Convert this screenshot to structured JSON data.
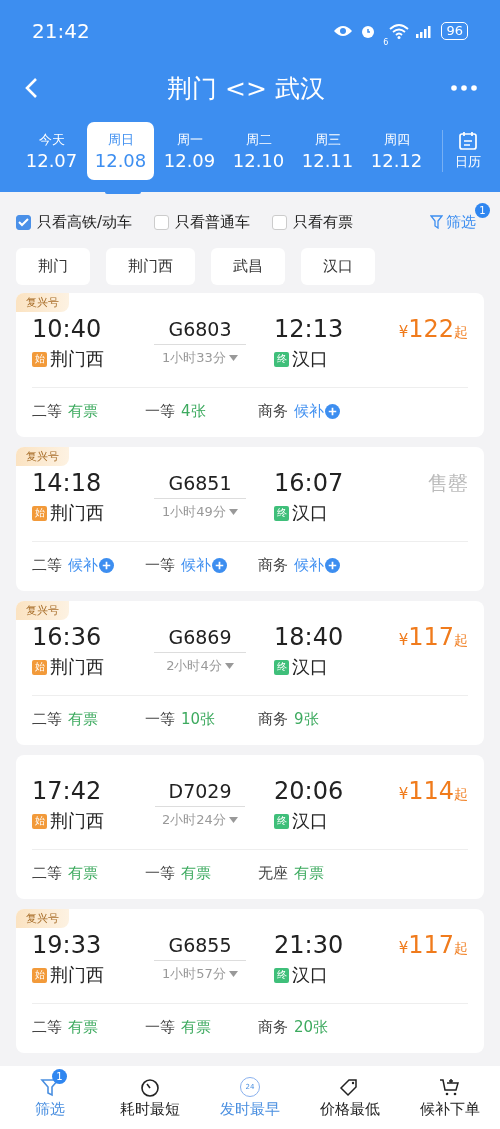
{
  "status_bar": {
    "time": "21:42",
    "network": "6",
    "battery": "96"
  },
  "header": {
    "title": "荆门 <> 武汉",
    "calendar": "日历"
  },
  "date_tabs": [
    {
      "weekday": "今天",
      "date": "12.07",
      "selected": false
    },
    {
      "weekday": "周日",
      "date": "12.08",
      "selected": true
    },
    {
      "weekday": "周一",
      "date": "12.09",
      "selected": false
    },
    {
      "weekday": "周二",
      "date": "12.10",
      "selected": false
    },
    {
      "weekday": "周三",
      "date": "12.11",
      "selected": false
    },
    {
      "weekday": "周四",
      "date": "12.12",
      "selected": false
    }
  ],
  "filters": [
    {
      "label": "只看高铁/动车",
      "checked": true
    },
    {
      "label": "只看普通车",
      "checked": false
    },
    {
      "label": "只看有票",
      "checked": false
    }
  ],
  "filter_button": {
    "label": "筛选",
    "badge": "1"
  },
  "stations": [
    "荆门",
    "荆门西",
    "武昌",
    "汉口"
  ],
  "trains": [
    {
      "badge": "复兴号",
      "depart": "10:40",
      "train_no": "G6803",
      "arrive": "12:13",
      "from_tag": "始",
      "from": "荆门西",
      "duration": "1小时33分",
      "to_tag": "终",
      "to": "汉口",
      "kind": "price",
      "currency": "¥",
      "amount": "122",
      "suffix": "起",
      "seats": [
        {
          "class": "二等",
          "status": "有票",
          "kind": "available"
        },
        {
          "class": "一等",
          "status": "4张",
          "kind": "available"
        },
        {
          "class": "商务",
          "status": "候补",
          "kind": "waitlist"
        }
      ]
    },
    {
      "badge": "复兴号",
      "depart": "14:18",
      "train_no": "G6851",
      "arrive": "16:07",
      "from_tag": "始",
      "from": "荆门西",
      "duration": "1小时49分",
      "to_tag": "终",
      "to": "汉口",
      "kind": "soldout",
      "sold_out": "售罄",
      "seats": [
        {
          "class": "二等",
          "status": "候补",
          "kind": "waitlist"
        },
        {
          "class": "一等",
          "status": "候补",
          "kind": "waitlist"
        },
        {
          "class": "商务",
          "status": "候补",
          "kind": "waitlist"
        }
      ]
    },
    {
      "badge": "复兴号",
      "depart": "16:36",
      "train_no": "G6869",
      "arrive": "18:40",
      "from_tag": "始",
      "from": "荆门西",
      "duration": "2小时4分",
      "to_tag": "终",
      "to": "汉口",
      "kind": "price",
      "currency": "¥",
      "amount": "117",
      "suffix": "起",
      "seats": [
        {
          "class": "二等",
          "status": "有票",
          "kind": "available"
        },
        {
          "class": "一等",
          "status": "10张",
          "kind": "available"
        },
        {
          "class": "商务",
          "status": "9张",
          "kind": "available"
        }
      ]
    },
    {
      "depart": "17:42",
      "train_no": "D7029",
      "arrive": "20:06",
      "from_tag": "始",
      "from": "荆门西",
      "duration": "2小时24分",
      "to_tag": "终",
      "to": "汉口",
      "kind": "price",
      "currency": "¥",
      "amount": "114",
      "suffix": "起",
      "seats": [
        {
          "class": "二等",
          "status": "有票",
          "kind": "available"
        },
        {
          "class": "一等",
          "status": "有票",
          "kind": "available"
        },
        {
          "class": "无座",
          "status": "有票",
          "kind": "available"
        }
      ]
    },
    {
      "badge": "复兴号",
      "depart": "19:33",
      "train_no": "G6855",
      "arrive": "21:30",
      "from_tag": "始",
      "from": "荆门西",
      "duration": "1小时57分",
      "to_tag": "终",
      "to": "汉口",
      "kind": "price",
      "currency": "¥",
      "amount": "117",
      "suffix": "起",
      "seats": [
        {
          "class": "二等",
          "status": "有票",
          "kind": "available"
        },
        {
          "class": "一等",
          "status": "有票",
          "kind": "available"
        },
        {
          "class": "商务",
          "status": "20张",
          "kind": "available"
        }
      ]
    }
  ],
  "bottom_nav": [
    {
      "label": "筛选",
      "kind": "filter",
      "selected": true,
      "badge": "1"
    },
    {
      "label": "耗时最短",
      "kind": "timer",
      "selected": false
    },
    {
      "label": "发时最早",
      "kind": "clock24",
      "icon_text": "24",
      "selected": true
    },
    {
      "label": "价格最低",
      "kind": "tag",
      "selected": false
    },
    {
      "label": "候补下单",
      "kind": "cart",
      "selected": false
    }
  ]
}
